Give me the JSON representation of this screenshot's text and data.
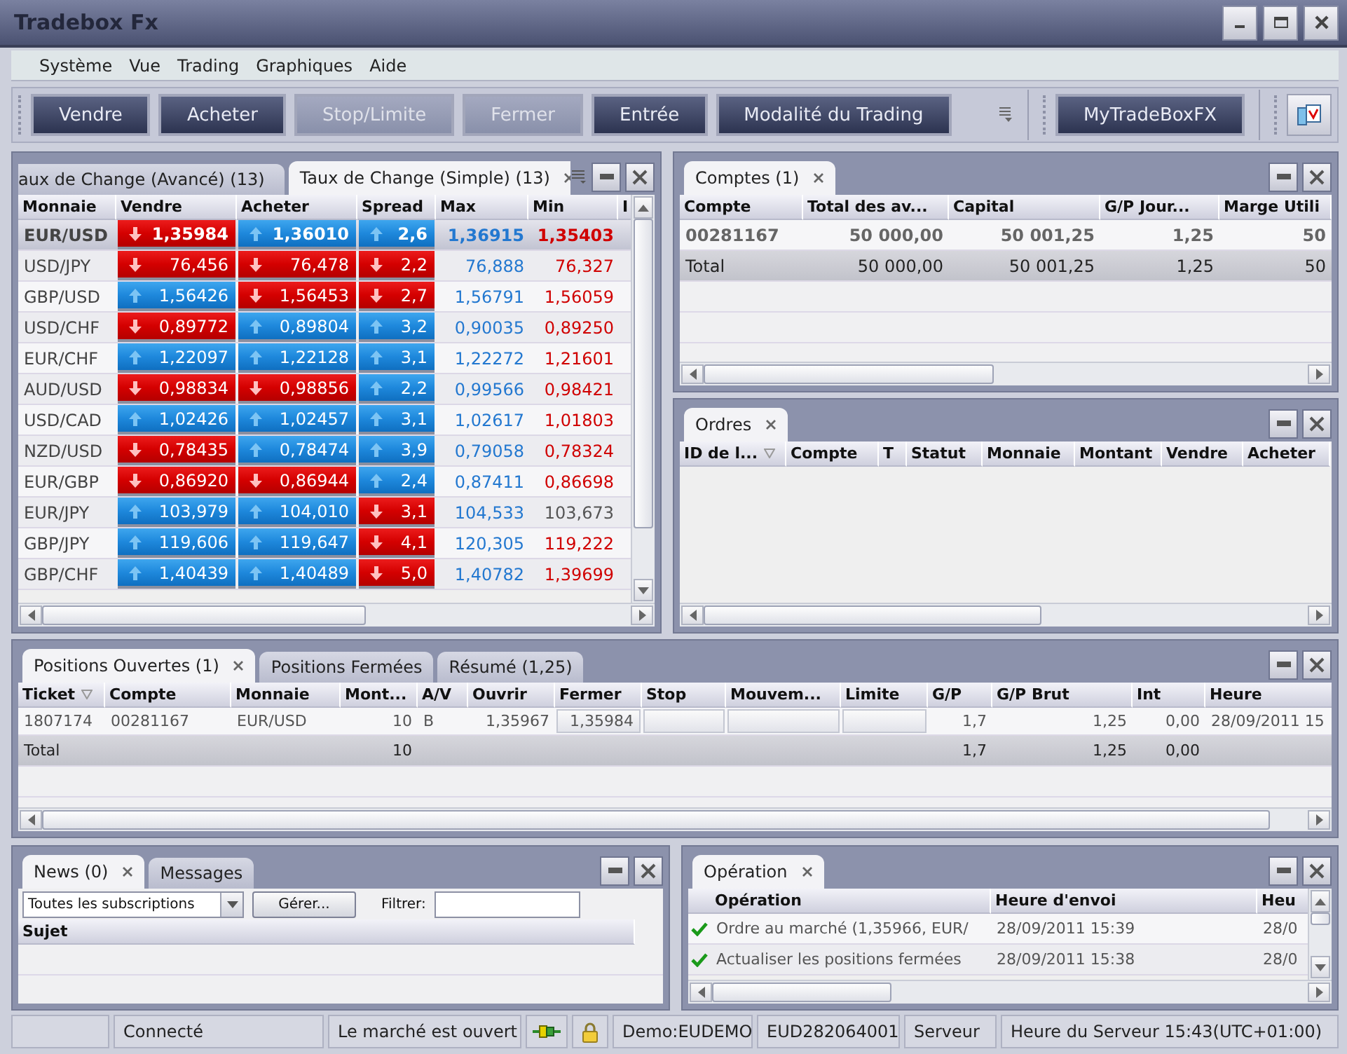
{
  "window": {
    "title": "Tradebox Fx"
  },
  "menu": [
    "Système",
    "Vue",
    "Trading",
    "Graphiques",
    "Aide"
  ],
  "toolbar": {
    "buttons": [
      {
        "label": "Vendre",
        "disabled": false
      },
      {
        "label": "Acheter",
        "disabled": false
      },
      {
        "label": "Stop/Limite",
        "disabled": true
      },
      {
        "label": "Fermer",
        "disabled": true
      },
      {
        "label": "Entrée",
        "disabled": false
      },
      {
        "label": "Modalité du Trading",
        "disabled": false
      }
    ],
    "account_button": "MyTradeBoxFX"
  },
  "rates_panel": {
    "tabs": [
      {
        "label": "aux de Change (Avancé) (13)",
        "selected": false
      },
      {
        "label": "Taux de Change (Simple) (13)",
        "selected": true
      }
    ],
    "columns": [
      "Monnaie",
      "Vendre",
      "Acheter",
      "Spread",
      "Max",
      "Min",
      "I"
    ],
    "rows": [
      {
        "pair": "EUR/USD",
        "selected": true,
        "sell": {
          "value": "1,35984",
          "rising": false
        },
        "buy": {
          "value": "1,36010",
          "rising": true
        },
        "spread": {
          "value": "2,6",
          "rising": true
        },
        "max": "1,36915",
        "min": {
          "value": "1,35403",
          "color": "#d00000"
        }
      },
      {
        "pair": "USD/JPY",
        "selected": false,
        "sell": {
          "value": "76,456",
          "rising": false
        },
        "buy": {
          "value": "76,478",
          "rising": false
        },
        "spread": {
          "value": "2,2",
          "rising": false
        },
        "max": "76,888",
        "min": {
          "value": "76,327",
          "color": "#d00000"
        }
      },
      {
        "pair": "GBP/USD",
        "selected": false,
        "sell": {
          "value": "1,56426",
          "rising": true
        },
        "buy": {
          "value": "1,56453",
          "rising": false
        },
        "spread": {
          "value": "2,7",
          "rising": false
        },
        "max": "1,56791",
        "min": {
          "value": "1,56059",
          "color": "#d00000"
        }
      },
      {
        "pair": "USD/CHF",
        "selected": false,
        "sell": {
          "value": "0,89772",
          "rising": false
        },
        "buy": {
          "value": "0,89804",
          "rising": true
        },
        "spread": {
          "value": "3,2",
          "rising": true
        },
        "max": "0,90035",
        "min": {
          "value": "0,89250",
          "color": "#d00000"
        }
      },
      {
        "pair": "EUR/CHF",
        "selected": false,
        "sell": {
          "value": "1,22097",
          "rising": true
        },
        "buy": {
          "value": "1,22128",
          "rising": true
        },
        "spread": {
          "value": "3,1",
          "rising": true
        },
        "max": "1,22272",
        "min": {
          "value": "1,21601",
          "color": "#d00000"
        }
      },
      {
        "pair": "AUD/USD",
        "selected": false,
        "sell": {
          "value": "0,98834",
          "rising": false
        },
        "buy": {
          "value": "0,98856",
          "rising": false
        },
        "spread": {
          "value": "2,2",
          "rising": true
        },
        "max": "0,99566",
        "min": {
          "value": "0,98421",
          "color": "#d00000"
        }
      },
      {
        "pair": "USD/CAD",
        "selected": false,
        "sell": {
          "value": "1,02426",
          "rising": true
        },
        "buy": {
          "value": "1,02457",
          "rising": true
        },
        "spread": {
          "value": "3,1",
          "rising": true
        },
        "max": "1,02617",
        "min": {
          "value": "1,01803",
          "color": "#d00000"
        }
      },
      {
        "pair": "NZD/USD",
        "selected": false,
        "sell": {
          "value": "0,78435",
          "rising": false
        },
        "buy": {
          "value": "0,78474",
          "rising": true
        },
        "spread": {
          "value": "3,9",
          "rising": true
        },
        "max": "0,79058",
        "min": {
          "value": "0,78324",
          "color": "#d00000"
        }
      },
      {
        "pair": "EUR/GBP",
        "selected": false,
        "sell": {
          "value": "0,86920",
          "rising": false
        },
        "buy": {
          "value": "0,86944",
          "rising": false
        },
        "spread": {
          "value": "2,4",
          "rising": true
        },
        "max": "0,87411",
        "min": {
          "value": "0,86698",
          "color": "#d00000"
        }
      },
      {
        "pair": "EUR/JPY",
        "selected": false,
        "sell": {
          "value": "103,979",
          "rising": true
        },
        "buy": {
          "value": "104,010",
          "rising": true
        },
        "spread": {
          "value": "3,1",
          "rising": false
        },
        "max": "104,533",
        "min": {
          "value": "103,673",
          "color": "#555555"
        }
      },
      {
        "pair": "GBP/JPY",
        "selected": false,
        "sell": {
          "value": "119,606",
          "rising": true
        },
        "buy": {
          "value": "119,647",
          "rising": true
        },
        "spread": {
          "value": "4,1",
          "rising": false
        },
        "max": "120,305",
        "min": {
          "value": "119,222",
          "color": "#d00000"
        }
      },
      {
        "pair": "GBP/CHF",
        "selected": false,
        "sell": {
          "value": "1,40439",
          "rising": true
        },
        "buy": {
          "value": "1,40489",
          "rising": true
        },
        "spread": {
          "value": "5,0",
          "rising": false
        },
        "max": "1,40782",
        "min": {
          "value": "1,39699",
          "color": "#d00000"
        }
      }
    ]
  },
  "accounts_panel": {
    "tabs": [
      {
        "label": "Comptes (1)",
        "selected": true
      }
    ],
    "columns": [
      "Compte",
      "Total des av...",
      "Capital",
      "G/P Jour...",
      "Marge Utili"
    ],
    "rows": [
      {
        "kind": "account",
        "cells": [
          "00281167",
          "50 000,00",
          "50 001,25",
          "1,25",
          "50"
        ]
      },
      {
        "kind": "total",
        "cells": [
          "Total",
          "50 000,00",
          "50 001,25",
          "1,25",
          "50"
        ]
      }
    ]
  },
  "orders_panel": {
    "tabs": [
      {
        "label": "Ordres",
        "selected": true
      }
    ],
    "columns": [
      {
        "label": "ID de l...",
        "sorted": true
      },
      {
        "label": "Compte",
        "sorted": false
      },
      {
        "label": "T",
        "sorted": false
      },
      {
        "label": "Statut",
        "sorted": false
      },
      {
        "label": "Monnaie",
        "sorted": false
      },
      {
        "label": "Montant",
        "sorted": false
      },
      {
        "label": "Vendre",
        "sorted": false
      },
      {
        "label": "Acheter",
        "sorted": false
      }
    ]
  },
  "positions_panel": {
    "tabs": [
      {
        "label": "Positions Ouvertes (1)",
        "selected": true
      },
      {
        "label": "Positions Fermées",
        "selected": false
      },
      {
        "label": "Résumé (1,25)",
        "selected": false
      }
    ],
    "columns": [
      {
        "label": "Ticket",
        "sorted": true
      },
      {
        "label": "Compte",
        "sorted": false
      },
      {
        "label": "Monnaie",
        "sorted": false
      },
      {
        "label": "Mont...",
        "sorted": false
      },
      {
        "label": "A/V",
        "sorted": false
      },
      {
        "label": "Ouvrir",
        "sorted": false
      },
      {
        "label": "Fermer",
        "sorted": false
      },
      {
        "label": "Stop",
        "sorted": false
      },
      {
        "label": "Mouvem...",
        "sorted": false
      },
      {
        "label": "Limite",
        "sorted": false
      },
      {
        "label": "G/P",
        "sorted": false
      },
      {
        "label": "G/P Brut",
        "sorted": false
      },
      {
        "label": "Int",
        "sorted": false
      },
      {
        "label": "Heure",
        "sorted": false
      }
    ],
    "rows": [
      {
        "kind": "position",
        "cells": [
          "1807174",
          "00281167",
          "EUR/USD",
          "10",
          "B",
          "1,35967",
          "1,35984",
          null,
          null,
          null,
          "1,7",
          "1,25",
          "0,00",
          "28/09/2011 15"
        ]
      },
      {
        "kind": "total",
        "cells": [
          "Total",
          null,
          null,
          "10",
          null,
          null,
          null,
          null,
          null,
          null,
          "1,7",
          "1,25",
          "0,00",
          null
        ]
      }
    ]
  },
  "news_panel": {
    "tabs": [
      {
        "label": "News (0)",
        "selected": true
      },
      {
        "label": "Messages",
        "selected": false
      }
    ],
    "subscription": "Toutes les subscriptions",
    "manage_button": "Gérer...",
    "filter_label": "Filtrer:",
    "columns": [
      "Sujet"
    ]
  },
  "operations_panel": {
    "tabs": [
      {
        "label": "Opération",
        "selected": true
      }
    ],
    "columns": [
      "Opération",
      "Heure d'envoi",
      "Heu"
    ],
    "rows": [
      {
        "done": true,
        "cells": [
          "Ordre au marché (1,35966, EUR/",
          "28/09/2011 15:39",
          "28/0"
        ]
      },
      {
        "done": true,
        "cells": [
          "Actualiser les positions fermées",
          "28/09/2011 15:38",
          "28/0"
        ]
      }
    ]
  },
  "status_bar": [
    {
      "kind": "blank"
    },
    {
      "kind": "text",
      "text": "Connecté"
    },
    {
      "kind": "text",
      "text": "Le marché est ouvert"
    },
    {
      "kind": "plug"
    },
    {
      "kind": "lock"
    },
    {
      "kind": "text",
      "text": "Demo:EUDEMO"
    },
    {
      "kind": "text",
      "text": "EUD282064001"
    },
    {
      "kind": "text",
      "text": "Serveur"
    },
    {
      "kind": "text",
      "text": "Heure du Serveur 15:43(UTC+01:00)"
    }
  ]
}
